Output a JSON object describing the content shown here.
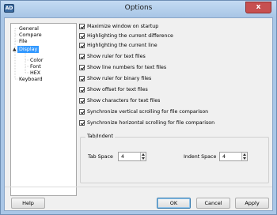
{
  "window": {
    "title": "Options",
    "app_icon_text": "AD",
    "close_label": "x"
  },
  "tree": {
    "items": [
      {
        "label": "General"
      },
      {
        "label": "Compare"
      },
      {
        "label": "File"
      },
      {
        "label": "Display",
        "selected": true,
        "expanded": true
      },
      {
        "label": "Color"
      },
      {
        "label": "Font"
      },
      {
        "label": "HEX"
      },
      {
        "label": "Keyboard"
      }
    ],
    "expander_symbol": "▲"
  },
  "options": [
    {
      "label": "Maximize window on startup",
      "checked": true
    },
    {
      "label": "Highlighting the current difference",
      "checked": true
    },
    {
      "label": "Highlighting the current line",
      "checked": true
    },
    {
      "label": "Show ruler for text files",
      "checked": true
    },
    {
      "label": "Show line numbers for text files",
      "checked": true
    },
    {
      "label": "Show ruler for binary files",
      "checked": true
    },
    {
      "label": "Show offset for text files",
      "checked": true
    },
    {
      "label": "Show characters for text files",
      "checked": true
    },
    {
      "label": "Synchronize vertical scrolling for file comparison",
      "checked": true
    },
    {
      "label": "Synchronize horizontal scrolling for file comparison",
      "checked": true
    }
  ],
  "tab_indent": {
    "title": "Tab/Indent",
    "tab_space_label": "Tab Space",
    "tab_space_value": "4",
    "indent_space_label": "Indent Space",
    "indent_space_value": "4"
  },
  "buttons": {
    "help": "Help",
    "ok": "OK",
    "cancel": "Cancel",
    "apply": "Apply"
  }
}
